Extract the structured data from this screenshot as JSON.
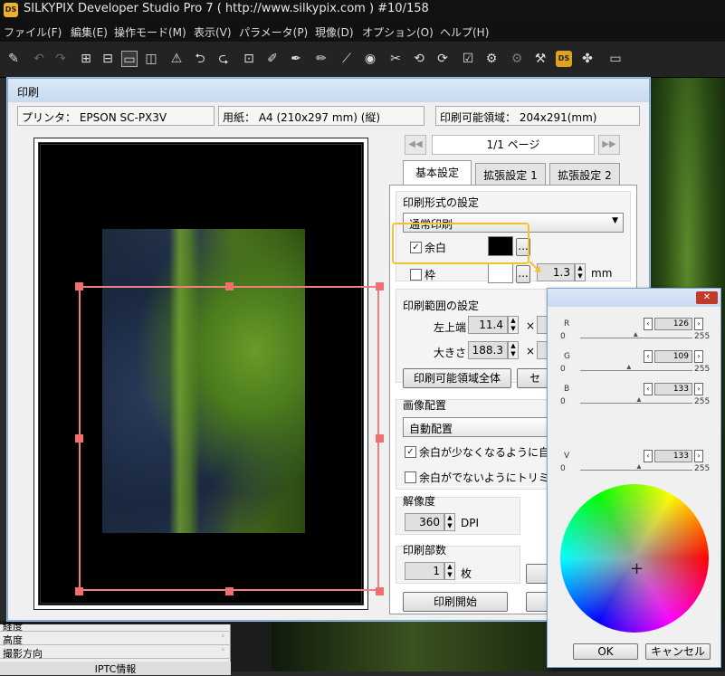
{
  "window": {
    "title": "SILKYPIX Developer Studio Pro 7 ( http://www.silkypix.com )   #10/158",
    "logo": "DS"
  },
  "menu": [
    "ファイル(F)",
    "編集(E)",
    "操作モード(M)",
    "表示(V)",
    "パラメータ(P)",
    "現像(D)",
    "オプション(O)",
    "ヘルプ(H)"
  ],
  "toolbar": {
    "badge": "DS"
  },
  "dialog": {
    "title": "印刷",
    "printer": "プリンタ： EPSON SC-PX3V",
    "paper": "用紙： A4 (210x297 mm) (縦)",
    "printable": "印刷可能領域： 204x291(mm)",
    "page": "1/1 ページ",
    "tabs": [
      "基本設定",
      "拡張設定 1",
      "拡張設定 2"
    ],
    "format": {
      "title": "印刷形式の設定",
      "mode": "通常印刷",
      "margin_label": "余白",
      "margin_checked": true,
      "frame_label": "枠",
      "frame_checked": false,
      "frame_width": "1.3",
      "unit": "mm",
      "dots": "..."
    },
    "range": {
      "title": "印刷範囲の設定",
      "topleft_label": "左上端",
      "topleft_value": "11.4",
      "size_label": "大きさ",
      "size_value": "188.3",
      "times": "×",
      "full_button": "印刷可能領域全体",
      "center_button": "セ"
    },
    "layout": {
      "title": "画像配置",
      "mode": "自動配置",
      "opt1": "余白が少なくなるように自",
      "opt1_checked": true,
      "opt2": "余白がでないようにトリミ",
      "opt2_checked": false
    },
    "resolution": {
      "title": "解像度",
      "value": "360",
      "unit": "DPI"
    },
    "copies": {
      "title": "印刷部数",
      "value": "1",
      "unit": "枚"
    },
    "start_button": "印刷開始"
  },
  "side_table": {
    "rows": [
      "経度",
      "高度",
      "撮影方向"
    ],
    "footer": "IPTC情報",
    "dot": "◦"
  },
  "color_picker": {
    "close": "✕",
    "channels": [
      {
        "label": "R",
        "value": "126",
        "min": "0",
        "max": "255",
        "level": 0.49
      },
      {
        "label": "G",
        "value": "109",
        "min": "0",
        "max": "255",
        "level": 0.43
      },
      {
        "label": "B",
        "value": "133",
        "min": "0",
        "max": "255",
        "level": 0.52
      },
      {
        "label": "V",
        "value": "133",
        "min": "0",
        "max": "255",
        "level": 0.52
      }
    ],
    "ok": "OK",
    "cancel": "キャンセル"
  },
  "colors": {
    "accent": "#f2c22a",
    "print_area": "#f08080",
    "margin_swatch": "#000000",
    "frame_swatch": "#ffffff"
  }
}
